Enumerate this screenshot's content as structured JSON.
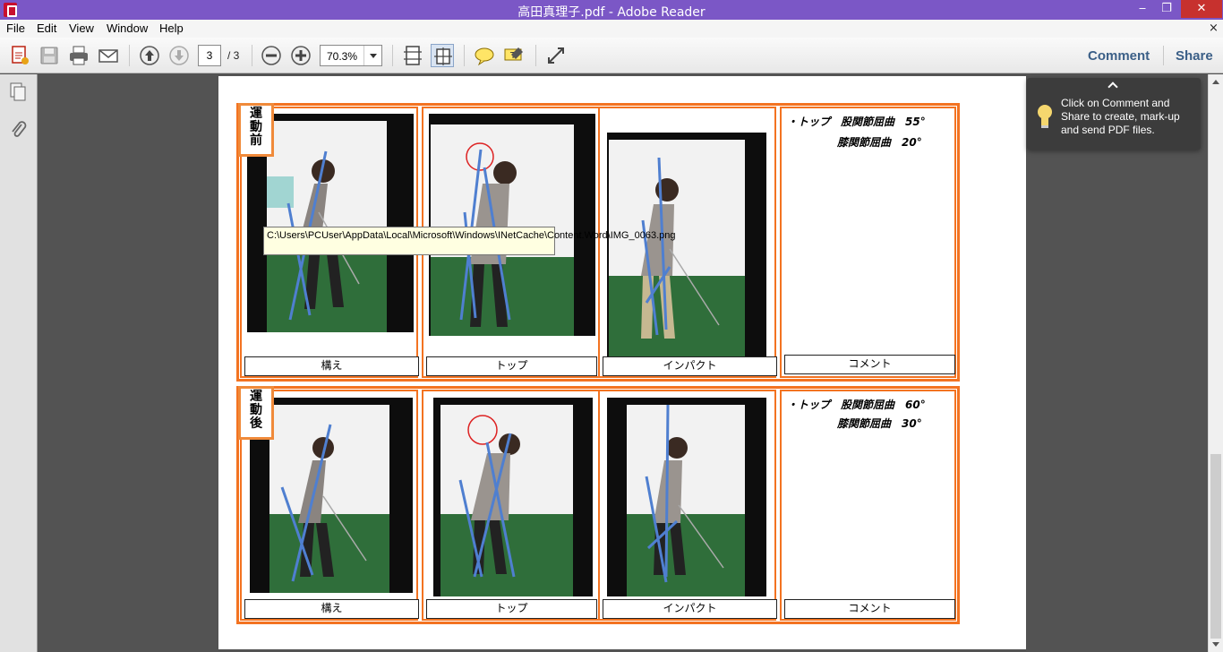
{
  "window": {
    "title": "高田真理子.pdf - Adobe Reader",
    "minimize_glyph": "‒",
    "maximize_glyph": "❐",
    "close_glyph": "✕"
  },
  "menu": {
    "items": [
      "File",
      "Edit",
      "View",
      "Window",
      "Help"
    ],
    "close_doc_glyph": "×"
  },
  "toolbar": {
    "current_page": "3",
    "page_total": "/ 3",
    "zoom": "70.3%",
    "comment_label": "Comment",
    "share_label": "Share"
  },
  "hint": {
    "text": "Click on Comment and Share to create, mark-up and send PDF files."
  },
  "tooltip": {
    "text": "C:\\Users\\PCUser\\AppData\\Local\\Microsoft\\Windows\\INetCache\\Content.Word\\IMG_0063.png"
  },
  "document": {
    "before": {
      "tag": "運\n動\n前",
      "captions": [
        "構え",
        "トップ",
        "インパクト",
        "コメント"
      ],
      "comment_line1": "・トップ　股関節屈曲　55°",
      "comment_line2": "膝関節屈曲　20°"
    },
    "after": {
      "tag": "運\n動\n後",
      "captions": [
        "構え",
        "トップ",
        "インパクト",
        "コメント"
      ],
      "comment_line1": "・トップ　股関節屈曲　60°",
      "comment_line2": "膝関節屈曲　30°"
    }
  },
  "colors": {
    "titlebar": "#7b57c6",
    "table_border": "#f37321",
    "link": "#3b5f87",
    "analysis_line": "#4f7fd0"
  },
  "icons": [
    "pdf-app-icon",
    "create-pdf-icon",
    "save-icon",
    "print-icon",
    "email-icon",
    "previous-page-icon",
    "next-page-icon",
    "zoom-out-icon",
    "zoom-in-icon",
    "fit-page-icon",
    "fit-width-icon",
    "sticky-note-icon",
    "highlight-icon",
    "read-mode-icon",
    "pages-panel-icon",
    "attachments-panel-icon",
    "lightbulb-icon"
  ]
}
